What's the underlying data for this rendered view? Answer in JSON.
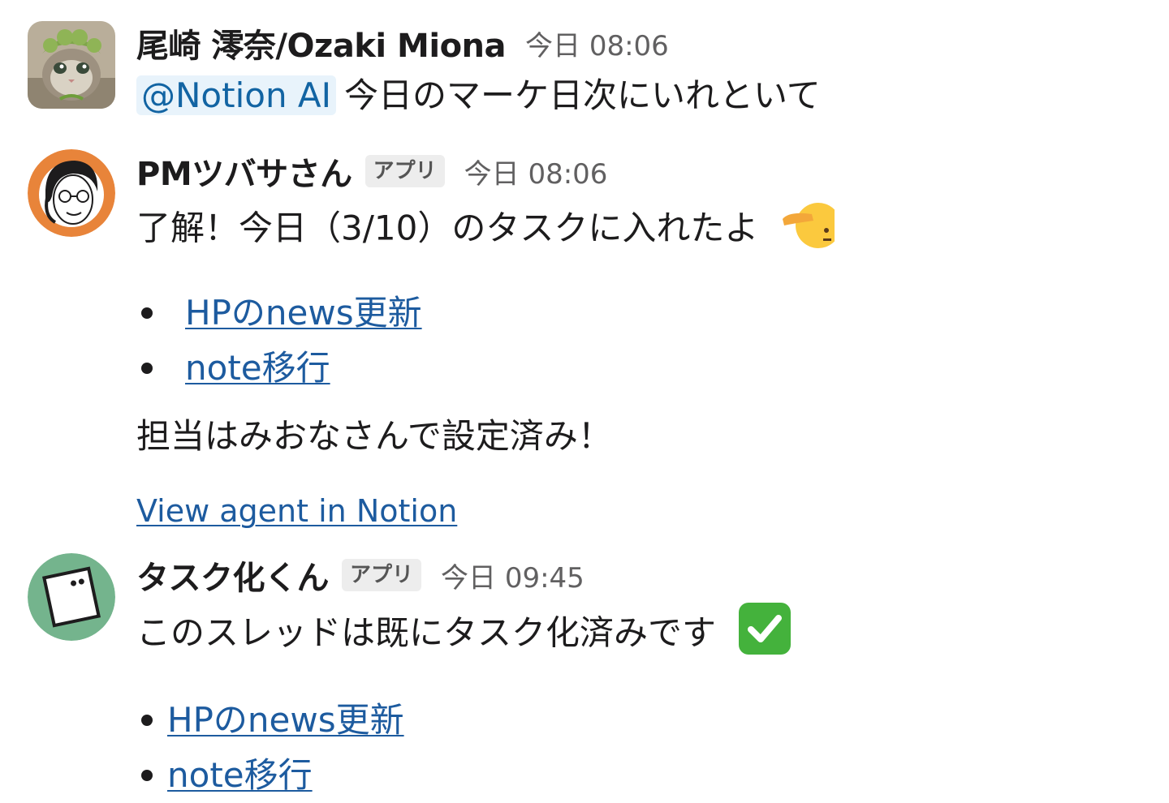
{
  "messages": [
    {
      "sender": "尾崎 澪奈/Ozaki Miona",
      "time": "今日 08:06",
      "mention": "@Notion AI",
      "text": "今日のマーケ日次にいれといて"
    },
    {
      "sender": "PMツバサさん",
      "badge": "アプリ",
      "time": "今日 08:06",
      "text": "了解！今日（3/10）のタスクに入れたよ",
      "emoji": "saluting-face-emoji",
      "tasks": [
        "HPのnews更新",
        "note移行"
      ],
      "assignee_text": "担当はみおなさんで設定済み！",
      "agent_link": "View agent in Notion"
    },
    {
      "sender": "タスク化くん",
      "badge": "アプリ",
      "time": "今日 09:45",
      "text": "このスレッドは既にタスク化済みです",
      "emoji": "check-mark-emoji",
      "tasks": [
        "HPのnews更新",
        "note移行"
      ]
    }
  ],
  "colors": {
    "link": "#1d5b9f",
    "mention_bg": "#e8f3fb",
    "mention_text": "#1264a3",
    "check_green": "#44b23c",
    "avatar3_bg": "#74b48d"
  }
}
